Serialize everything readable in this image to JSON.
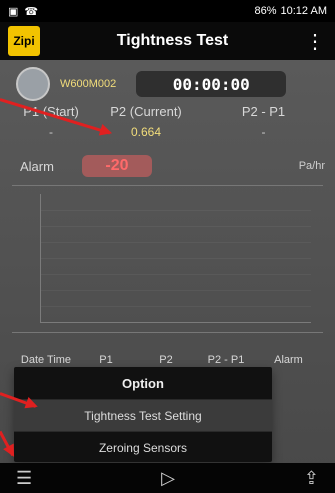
{
  "status": {
    "left_icons": [
      "▣",
      "☎"
    ],
    "right_text": "86%",
    "time": "10:12 AM"
  },
  "app": {
    "logo_text": "Zipi",
    "title": "Tightness Test",
    "menu_icon": "⋮"
  },
  "test": {
    "device_id": "W600M002",
    "timer": "00:00:00"
  },
  "pressure": {
    "p1_label": "P1 (Start)",
    "p1_value": "-",
    "p2_label": "P2 (Current)",
    "p2_value": "0.664",
    "diff_label": "P2 - P1",
    "diff_value": "-"
  },
  "alarm": {
    "label": "Alarm",
    "value": "-20",
    "unit": "Pa/hr"
  },
  "table": {
    "headers": [
      "Date Time",
      "P1",
      "P2",
      "P2 - P1",
      "Alarm"
    ]
  },
  "option_menu": {
    "title": "Option",
    "items": [
      "Tightness Test Setting",
      "Zeroing Sensors"
    ]
  },
  "bottom": {
    "list_icon": "☰",
    "play_icon": "▷",
    "export_icon": "⇪"
  }
}
